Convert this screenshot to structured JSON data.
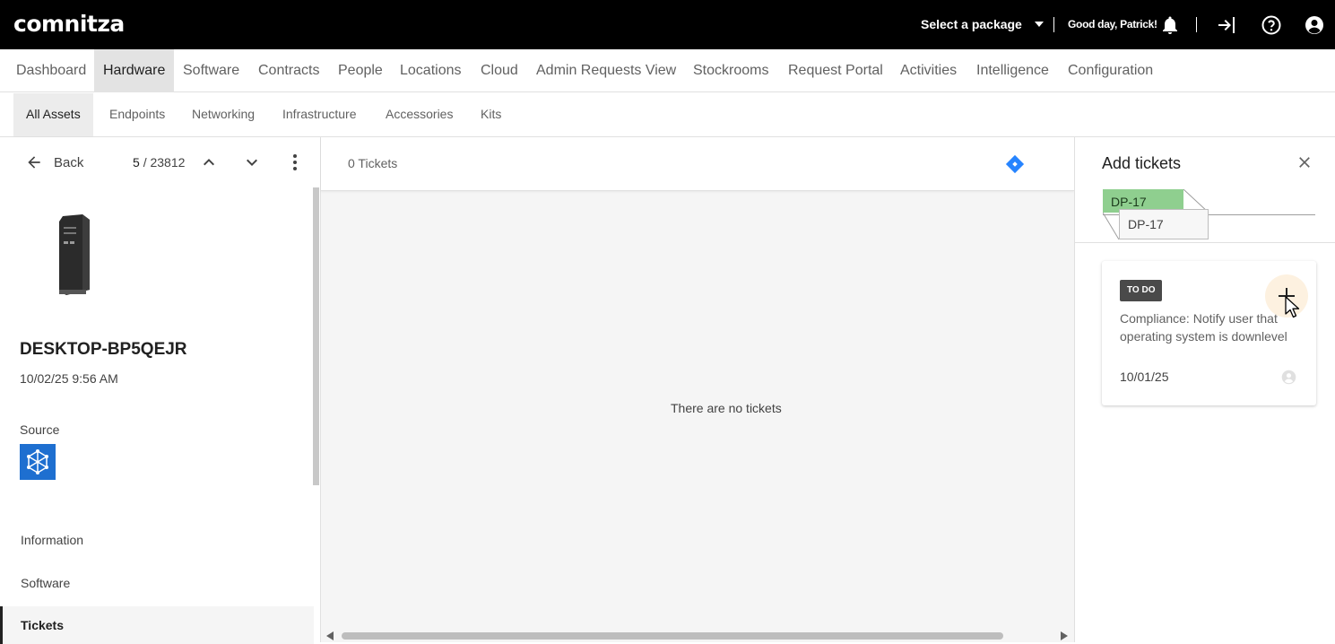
{
  "topbar": {
    "logo": "comnitza",
    "package_select": "Select a package",
    "greeting": "Good day, Patrick!",
    "icons": [
      "bell-icon",
      "sign-in-icon",
      "help-icon",
      "account-icon"
    ]
  },
  "mainnav": {
    "items": [
      "Dashboard",
      "Hardware",
      "Software",
      "Contracts",
      "People",
      "Locations",
      "Cloud",
      "Admin Requests View",
      "Stockrooms",
      "Request Portal",
      "Activities",
      "Intelligence",
      "Configuration"
    ],
    "active": "Hardware"
  },
  "subnav": {
    "items": [
      "All Assets",
      "Endpoints",
      "Networking",
      "Infrastructure",
      "Accessories",
      "Kits"
    ],
    "active": "All Assets"
  },
  "left": {
    "back_label": "Back",
    "pager_current": "5",
    "pager_total": "/ 23812",
    "asset_name": "DESKTOP-BP5QEJR",
    "asset_date": "10/02/25 9:56 AM",
    "source_label": "Source",
    "nav": [
      "Information",
      "Software",
      "Tickets"
    ],
    "active_nav": "Tickets"
  },
  "center": {
    "ticket_count": "0 Tickets",
    "empty_message": "There are no tickets"
  },
  "right": {
    "title": "Add tickets",
    "project_tag": "DP-17",
    "project_tag_drag": "DP-17",
    "card": {
      "status": "TO DO",
      "summary": "Compliance: Notify user that operating system is downlevel",
      "date": "10/01/25"
    }
  },
  "colors": {
    "topbar_bg": "#000000",
    "source_logo": "#1e6fd0",
    "jira_blue": "#2684ff",
    "tag_green": "#8fcf8f"
  }
}
